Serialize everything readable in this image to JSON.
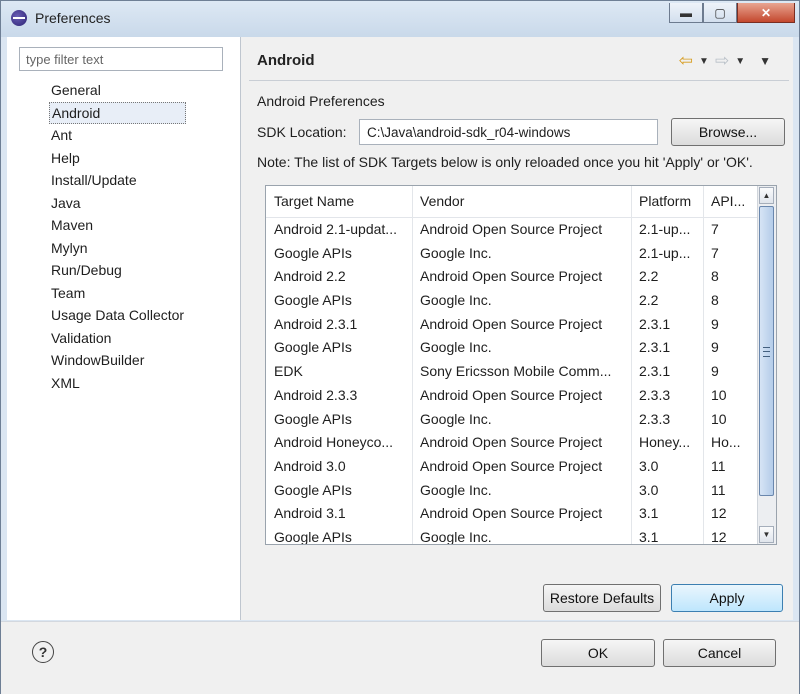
{
  "window": {
    "title": "Preferences",
    "controls": {
      "minimize": "▬",
      "maximize": "▢",
      "close": "✕"
    }
  },
  "sidebar": {
    "filter_placeholder": "type filter text",
    "items": [
      {
        "label": "General"
      },
      {
        "label": "Android",
        "selected": true
      },
      {
        "label": "Ant"
      },
      {
        "label": "Help"
      },
      {
        "label": "Install/Update"
      },
      {
        "label": "Java"
      },
      {
        "label": "Maven"
      },
      {
        "label": "Mylyn"
      },
      {
        "label": "Run/Debug"
      },
      {
        "label": "Team"
      },
      {
        "label": "Usage Data Collector"
      },
      {
        "label": "Validation"
      },
      {
        "label": "WindowBuilder"
      },
      {
        "label": "XML"
      }
    ]
  },
  "page": {
    "title": "Android",
    "nav": {
      "back_icon": "⇦",
      "forward_icon": "⇨",
      "dropdown_icon": "▼",
      "menu_icon": "▼"
    },
    "subtitle": "Android Preferences",
    "sdk_label": "SDK Location:",
    "sdk_value": "C:\\Java\\android-sdk_r04-windows",
    "browse_label": "Browse...",
    "note": "Note: The list of SDK Targets below is only reloaded once you hit 'Apply' or 'OK'.",
    "restore_label": "Restore Defaults",
    "apply_label": "Apply"
  },
  "targets": {
    "columns": [
      "Target Name",
      "Vendor",
      "Platform",
      "API..."
    ],
    "rows": [
      [
        "Android 2.1-updat...",
        "Android Open Source Project",
        "2.1-up...",
        "7"
      ],
      [
        "Google APIs",
        "Google Inc.",
        "2.1-up...",
        "7"
      ],
      [
        "Android 2.2",
        "Android Open Source Project",
        "2.2",
        "8"
      ],
      [
        "Google APIs",
        "Google Inc.",
        "2.2",
        "8"
      ],
      [
        "Android 2.3.1",
        "Android Open Source Project",
        "2.3.1",
        "9"
      ],
      [
        "Google APIs",
        "Google Inc.",
        "2.3.1",
        "9"
      ],
      [
        "EDK",
        "Sony Ericsson Mobile Comm...",
        "2.3.1",
        "9"
      ],
      [
        "Android 2.3.3",
        "Android Open Source Project",
        "2.3.3",
        "10"
      ],
      [
        "Google APIs",
        "Google Inc.",
        "2.3.3",
        "10"
      ],
      [
        "Android Honeyco...",
        "Android Open Source Project",
        "Honey...",
        "Ho..."
      ],
      [
        "Android 3.0",
        "Android Open Source Project",
        "3.0",
        "11"
      ],
      [
        "Google APIs",
        "Google Inc.",
        "3.0",
        "11"
      ],
      [
        "Android 3.1",
        "Android Open Source Project",
        "3.1",
        "12"
      ],
      [
        "Google APIs",
        "Google Inc.",
        "3.1",
        "12"
      ]
    ]
  },
  "footer": {
    "help_icon": "?",
    "ok_label": "OK",
    "cancel_label": "Cancel"
  }
}
